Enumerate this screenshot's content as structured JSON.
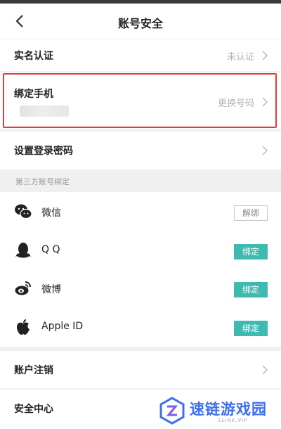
{
  "header": {
    "title": "账号安全"
  },
  "rows": {
    "real_name": {
      "label": "实名认证",
      "value": "未认证"
    },
    "bind_phone": {
      "label": "绑定手机",
      "value": "更换号码"
    },
    "login_password": {
      "label": "设置登录密码"
    },
    "account_cancel": {
      "label": "账户注销"
    },
    "security_center": {
      "label": "安全中心"
    }
  },
  "third_party": {
    "section_label": "第三方账号绑定",
    "accounts": [
      {
        "name": "微信",
        "button": "解绑",
        "icon": "wechat-icon"
      },
      {
        "name": "Q Q",
        "button": "绑定",
        "icon": "qq-icon"
      },
      {
        "name": "微博",
        "button": "绑定",
        "icon": "weibo-icon"
      },
      {
        "name": "Apple ID",
        "button": "绑定",
        "icon": "apple-icon"
      }
    ]
  },
  "colors": {
    "accent": "#3fbab0",
    "highlight": "#e23b3b",
    "watermark": "#3d6ef0"
  },
  "watermark": {
    "text": "速链游戏园",
    "sub": "SLINK.VIP"
  }
}
